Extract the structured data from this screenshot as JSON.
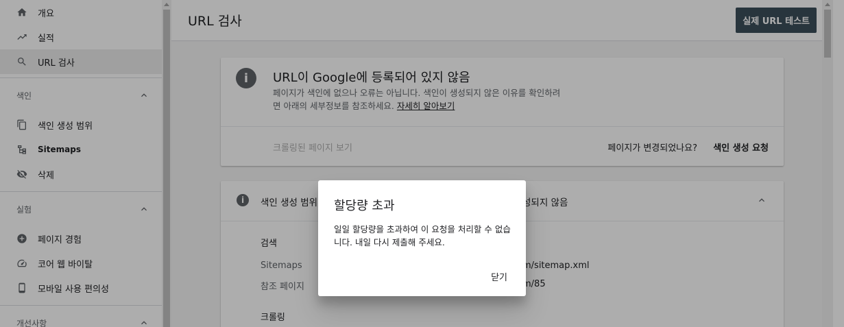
{
  "sidebar": {
    "items": [
      {
        "label": "개요",
        "icon": "home-icon"
      },
      {
        "label": "실적",
        "icon": "trending-up-icon"
      },
      {
        "label": "URL 검사",
        "icon": "search-icon",
        "active": true
      }
    ],
    "sections": [
      {
        "title": "색인",
        "items": [
          {
            "label": "색인 생성 범위",
            "icon": "copy-icon"
          },
          {
            "label": "Sitemaps",
            "icon": "sitemap-icon"
          },
          {
            "label": "삭제",
            "icon": "eye-off-icon"
          }
        ]
      },
      {
        "title": "실험",
        "items": [
          {
            "label": "페이지 경험",
            "icon": "plus-circle-icon"
          },
          {
            "label": "코어 웹 바이탈",
            "icon": "speed-icon"
          },
          {
            "label": "모바일 사용 편의성",
            "icon": "phone-icon"
          }
        ]
      },
      {
        "title": "개선사항",
        "items": []
      }
    ]
  },
  "header": {
    "title": "URL 검사",
    "test_button": "실제 URL 테스트"
  },
  "status_card": {
    "headline": "URL이 Google에 등록되어 있지 않음",
    "description_line1": "페이지가 색인에 없으나 오류는 아닙니다. 색인이 생성되지 않은 이유를 확인하려",
    "description_line2": "면 아래의 세부정보를 참조하세요.",
    "learn_more": "자세히 알아보기",
    "crawled_page": "크롤링된 페이지 보기",
    "changed_question": "페이지가 변경되었나요?",
    "request_indexing": "색인 생성 요청"
  },
  "coverage_card": {
    "title_left": "색인 생성 범위",
    "title_right": "성되지 않음",
    "discovery_label": "검색",
    "rows": [
      {
        "key": "Sitemaps",
        "value": "m/sitemap.xml"
      },
      {
        "key": "참조 페이지",
        "value": "m/85"
      }
    ],
    "crawl_label": "크롤링"
  },
  "dialog": {
    "title": "할당량 초과",
    "body": "일일 할당량을 초과하여 이 요청을 처리할 수 없습니다. 내일 다시 제출해 주세요.",
    "close": "닫기"
  }
}
